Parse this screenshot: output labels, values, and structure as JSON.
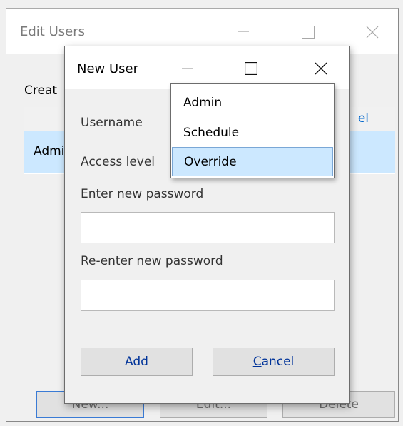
{
  "outer_window": {
    "title": "Edit Users",
    "content_label": "Creat",
    "table": {
      "header_label": "el",
      "row_value": "Admi"
    },
    "buttons": {
      "new_label": "New...",
      "edit_label": "Edit...",
      "delete_label": "Delete"
    }
  },
  "dialog": {
    "title": "New User",
    "username_label": "Username",
    "access_level_label": "Access level",
    "new_password_label": "Enter new password",
    "reenter_password_label": "Re-enter new password",
    "new_password_value": "",
    "reenter_password_value": "",
    "add_label": "Add",
    "cancel_first_letter": "C",
    "cancel_rest": "ancel"
  },
  "access_level_dropdown": {
    "options": [
      "Admin",
      "Schedule",
      "Override"
    ],
    "highlighted": "Override"
  },
  "colors": {
    "selection": "#cce8ff",
    "link_blue": "#0066cc",
    "button_text": "#003399"
  }
}
